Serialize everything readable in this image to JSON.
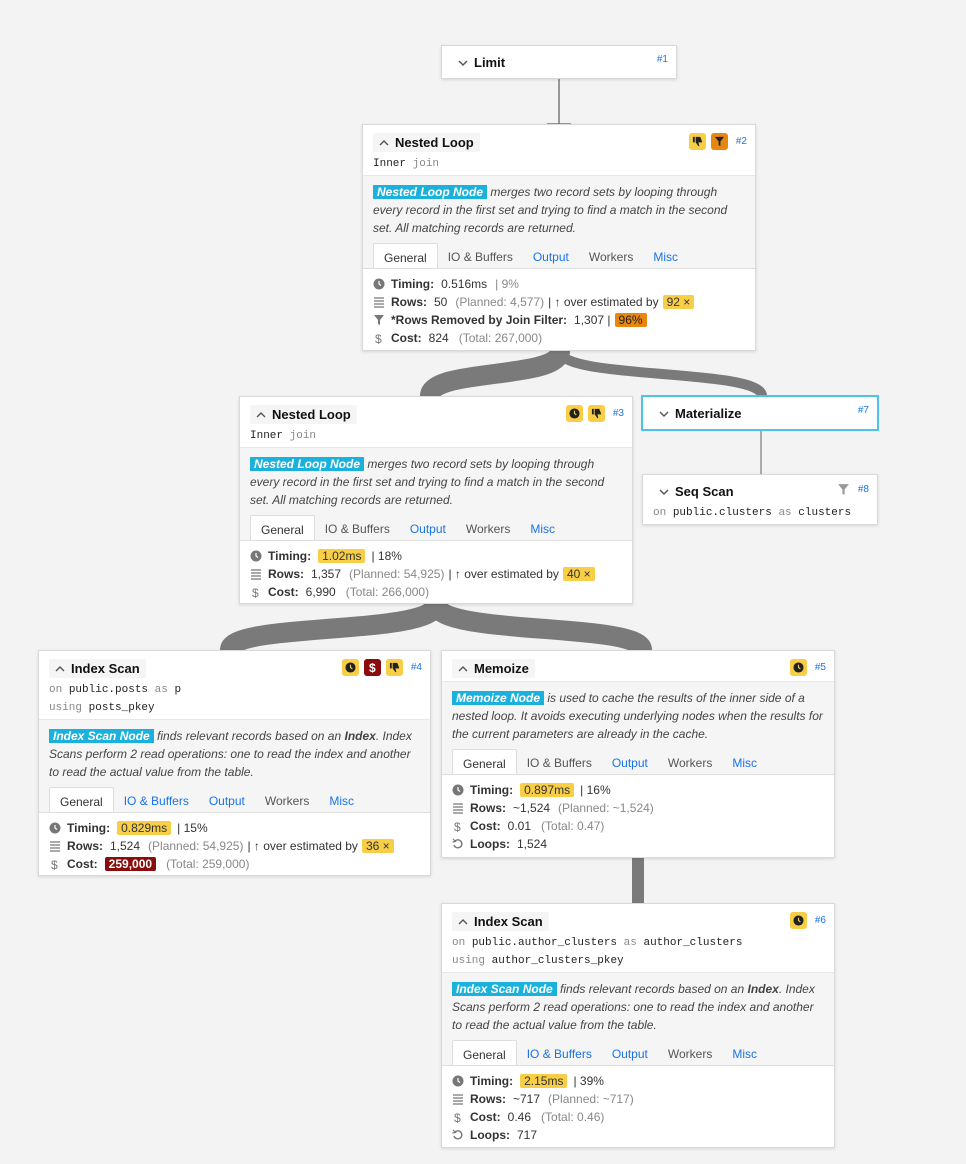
{
  "nodes": {
    "n1": {
      "title": "Limit",
      "id": "#1"
    },
    "n2": {
      "title": "Nested Loop",
      "id": "#2",
      "sub_word": "Inner",
      "sub_kw": "join",
      "tag": "Nested Loop Node",
      "desc": " merges two record sets by looping through every record in the first set and trying to find a match in the second set. All matching records are returned.",
      "tabs": [
        "General",
        "IO & Buffers",
        "Output",
        "Workers",
        "Misc"
      ],
      "timing_label": "Timing:",
      "timing": "0.516ms",
      "timing_pct": "| 9%",
      "rows_label": "Rows:",
      "rows": "50",
      "rows_planned": "(Planned: 4,577)",
      "rows_est": "| ↑ over estimated by",
      "rows_factor": "92 ×",
      "filter_label": "*Rows Removed by Join Filter:",
      "filter": "1,307 |",
      "filter_pct": "96%",
      "cost_label": "Cost:",
      "cost": "824",
      "cost_total": "(Total: 267,000)"
    },
    "n3": {
      "title": "Nested Loop",
      "id": "#3",
      "sub_word": "Inner",
      "sub_kw": "join",
      "tag": "Nested Loop Node",
      "desc": " merges two record sets by looping through every record in the first set and trying to find a match in the second set. All matching records are returned.",
      "tabs": [
        "General",
        "IO & Buffers",
        "Output",
        "Workers",
        "Misc"
      ],
      "timing_label": "Timing:",
      "timing": "1.02ms",
      "timing_pct": "| 18%",
      "rows_label": "Rows:",
      "rows": "1,357",
      "rows_planned": "(Planned: 54,925)",
      "rows_est": "| ↑ over estimated by",
      "rows_factor": "40 ×",
      "cost_label": "Cost:",
      "cost": "6,990",
      "cost_total": "(Total: 266,000)"
    },
    "n7": {
      "title": "Materialize",
      "id": "#7"
    },
    "n8": {
      "title": "Seq Scan",
      "id": "#8",
      "on": "on",
      "table": "public.clusters",
      "as": "as",
      "alias": "clusters"
    },
    "n4": {
      "title": "Index Scan",
      "id": "#4",
      "on": "on",
      "table": "public.posts",
      "as": "as",
      "alias": "p",
      "using": "using",
      "index": "posts_pkey",
      "tag": "Index Scan Node",
      "desc1": " finds relevant records based on an ",
      "desc_b": "Index",
      "desc2": ". Index Scans perform 2 read operations: one to read the index and another to read the actual value from the table.",
      "tabs": [
        "General",
        "IO & Buffers",
        "Output",
        "Workers",
        "Misc"
      ],
      "timing_label": "Timing:",
      "timing": "0.829ms",
      "timing_pct": "| 15%",
      "rows_label": "Rows:",
      "rows": "1,524",
      "rows_planned": "(Planned: 54,925)",
      "rows_est": "| ↑ over estimated by",
      "rows_factor": "36 ×",
      "cost_label": "Cost:",
      "cost": "259,000",
      "cost_total": "(Total: 259,000)"
    },
    "n5": {
      "title": "Memoize",
      "id": "#5",
      "tag": "Memoize Node",
      "desc": " is used to cache the results of the inner side of a nested loop. It avoids executing underlying nodes when the results for the current parameters are already in the cache.",
      "tabs": [
        "General",
        "IO & Buffers",
        "Output",
        "Workers",
        "Misc"
      ],
      "timing_label": "Timing:",
      "timing": "0.897ms",
      "timing_pct": "| 16%",
      "rows_label": "Rows:",
      "rows": "~1,524",
      "rows_planned": "(Planned: ~1,524)",
      "cost_label": "Cost:",
      "cost": "0.01",
      "cost_total": "(Total: 0.47)",
      "loops_label": "Loops:",
      "loops": "1,524"
    },
    "n6": {
      "title": "Index Scan",
      "id": "#6",
      "on": "on",
      "table": "public.author_clusters",
      "as": "as",
      "alias": "author_clusters",
      "using": "using",
      "index": "author_clusters_pkey",
      "tag": "Index Scan Node",
      "desc1": " finds relevant records based on an ",
      "desc_b": "Index",
      "desc2": ". Index Scans perform 2 read operations: one to read the index and another to read the actual value from the table.",
      "tabs": [
        "General",
        "IO & Buffers",
        "Output",
        "Workers",
        "Misc"
      ],
      "timing_label": "Timing:",
      "timing": "2.15ms",
      "timing_pct": "| 39%",
      "rows_label": "Rows:",
      "rows": "~717",
      "rows_planned": "(Planned: ~717)",
      "cost_label": "Cost:",
      "cost": "0.46",
      "cost_total": "(Total: 0.46)",
      "loops_label": "Loops:",
      "loops": "717"
    }
  },
  "colors": {
    "accent": "#1ab1dc",
    "link": "#1a73e8",
    "warn": "#f7ce46",
    "danger": "#e8870f",
    "severe": "#8b0c0c",
    "edge": "#7a7a7a"
  },
  "icons": [
    "chevron-up-icon",
    "chevron-down-icon",
    "clock-icon",
    "thumbs-down-icon",
    "filter-icon",
    "dollar-icon",
    "rows-icon",
    "loop-icon",
    "up-arrow-icon"
  ]
}
